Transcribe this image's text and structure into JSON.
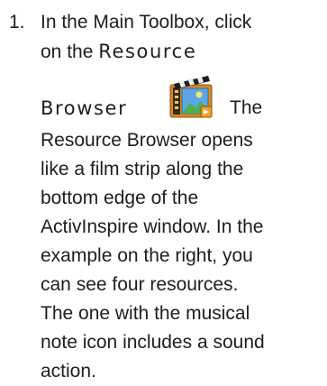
{
  "step": {
    "number": "1.",
    "line1": "In the Main Toolbox, click",
    "line2_prefix": "on the ",
    "line2_term": "Resource",
    "line3_term": "Browser",
    "line3_after": "The",
    "lines": [
      "Resource Browser opens",
      "like a film strip along the",
      "bottom edge of the",
      "ActivInspire window. In the",
      "example on the right, you",
      "can see four resources.",
      "The one with the musical",
      "note icon includes a sound",
      "action."
    ],
    "icon": "resource-browser-icon"
  }
}
